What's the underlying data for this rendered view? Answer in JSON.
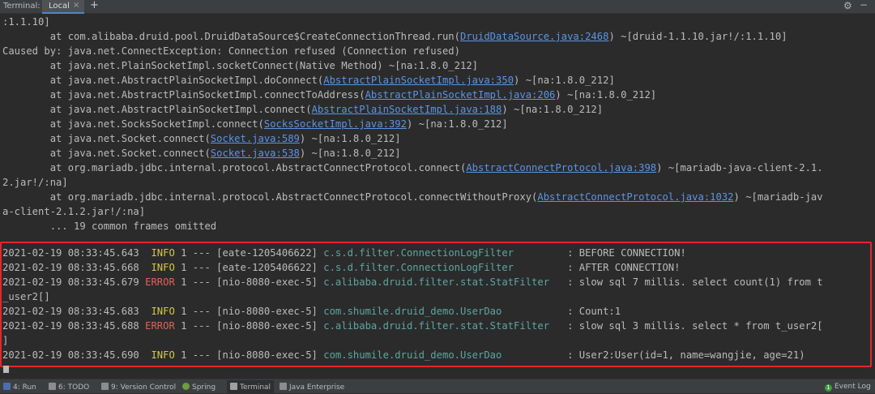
{
  "tabbar": {
    "title": "Terminal:",
    "tab_label": "Local",
    "close_glyph": "×",
    "add_glyph": "+",
    "settings_glyph": "⚙",
    "hide_glyph": "−"
  },
  "lines": [
    ":1.1.10]",
    "        at com.alibaba.druid.pool.DruidDataSource$CreateConnectionThread.run(",
    "DruidDataSource.java:2468",
    ") ~[druid-1.1.10.jar!/:1.1.10]",
    "Caused by: java.net.ConnectException: Connection refused (Connection refused)",
    "        at java.net.PlainSocketImpl.socketConnect(Native Method) ~[na:1.8.0_212]",
    "        at java.net.AbstractPlainSocketImpl.doConnect(",
    "AbstractPlainSocketImpl.java:350",
    ") ~[na:1.8.0_212]",
    "        at java.net.AbstractPlainSocketImpl.connectToAddress(",
    "AbstractPlainSocketImpl.java:206",
    ") ~[na:1.8.0_212]",
    "        at java.net.AbstractPlainSocketImpl.connect(",
    "AbstractPlainSocketImpl.java:188",
    ") ~[na:1.8.0_212]",
    "        at java.net.SocksSocketImpl.connect(",
    "SocksSocketImpl.java:392",
    ") ~[na:1.8.0_212]",
    "        at java.net.Socket.connect(",
    "Socket.java:589",
    ") ~[na:1.8.0_212]",
    "        at java.net.Socket.connect(",
    "Socket.java:538",
    ") ~[na:1.8.0_212]",
    "        at org.mariadb.jdbc.internal.protocol.AbstractConnectProtocol.connect(",
    "AbstractConnectProtocol.java:398",
    ") ~[mariadb-java-client-2.1.",
    "2.jar!/:na]",
    "        at org.mariadb.jdbc.internal.protocol.AbstractConnectProtocol.connectWithoutProxy(",
    "AbstractConnectProtocol.java:1032",
    ") ~[mariadb-jav",
    "a-client-2.1.2.jar!/:na]",
    "        ... 19 common frames omitted"
  ],
  "log": [
    {
      "ts": "2021-02-19 08:33:45.643",
      "level": " INFO",
      "mid": " 1 --- [eate-1205406622] ",
      "logger": "c.s.d.filter.ConnectionLogFilter        ",
      "msg": " : BEFORE CONNECTION!"
    },
    {
      "ts": "2021-02-19 08:33:45.668",
      "level": " INFO",
      "mid": " 1 --- [eate-1205406622] ",
      "logger": "c.s.d.filter.ConnectionLogFilter        ",
      "msg": " : AFTER CONNECTION!"
    },
    {
      "ts": "2021-02-19 08:33:45.679",
      "level": "ERROR",
      "mid": " 1 --- [nio-8080-exec-5] ",
      "logger": "c.alibaba.druid.filter.stat.StatFilter  ",
      "msg": " : slow sql 7 millis. select count(1) from t"
    },
    {
      "cont": "_user2[]"
    },
    {
      "ts": "2021-02-19 08:33:45.683",
      "level": " INFO",
      "mid": " 1 --- [nio-8080-exec-5] ",
      "logger": "com.shumile.druid_demo.UserDao          ",
      "msg": " : Count:1"
    },
    {
      "ts": "2021-02-19 08:33:45.688",
      "level": "ERROR",
      "mid": " 1 --- [nio-8080-exec-5] ",
      "logger": "c.alibaba.druid.filter.stat.StatFilter  ",
      "msg": " : slow sql 3 millis. select * from t_user2["
    },
    {
      "cont": "]"
    },
    {
      "ts": "2021-02-19 08:33:45.690",
      "level": " INFO",
      "mid": " 1 --- [nio-8080-exec-5] ",
      "logger": "com.shumile.druid_demo.UserDao          ",
      "msg": " : User2:User(id=1, name=wangjie, age=21)"
    }
  ],
  "status": {
    "run": "4: Run",
    "todo": "6: TODO",
    "vcs": "9: Version Control",
    "spring": "Spring",
    "terminal": "Terminal",
    "javaee": "Java Enterprise",
    "eventlog": "Event Log",
    "eventlog_count": "1"
  },
  "colors": {
    "background": "#2b2b2b",
    "text": "#bbbbbb",
    "link": "#5b94e6",
    "info": "#d7c64b",
    "error": "#e0605a",
    "logger": "#5fa5a0",
    "highlight_box": "#e3262b"
  }
}
